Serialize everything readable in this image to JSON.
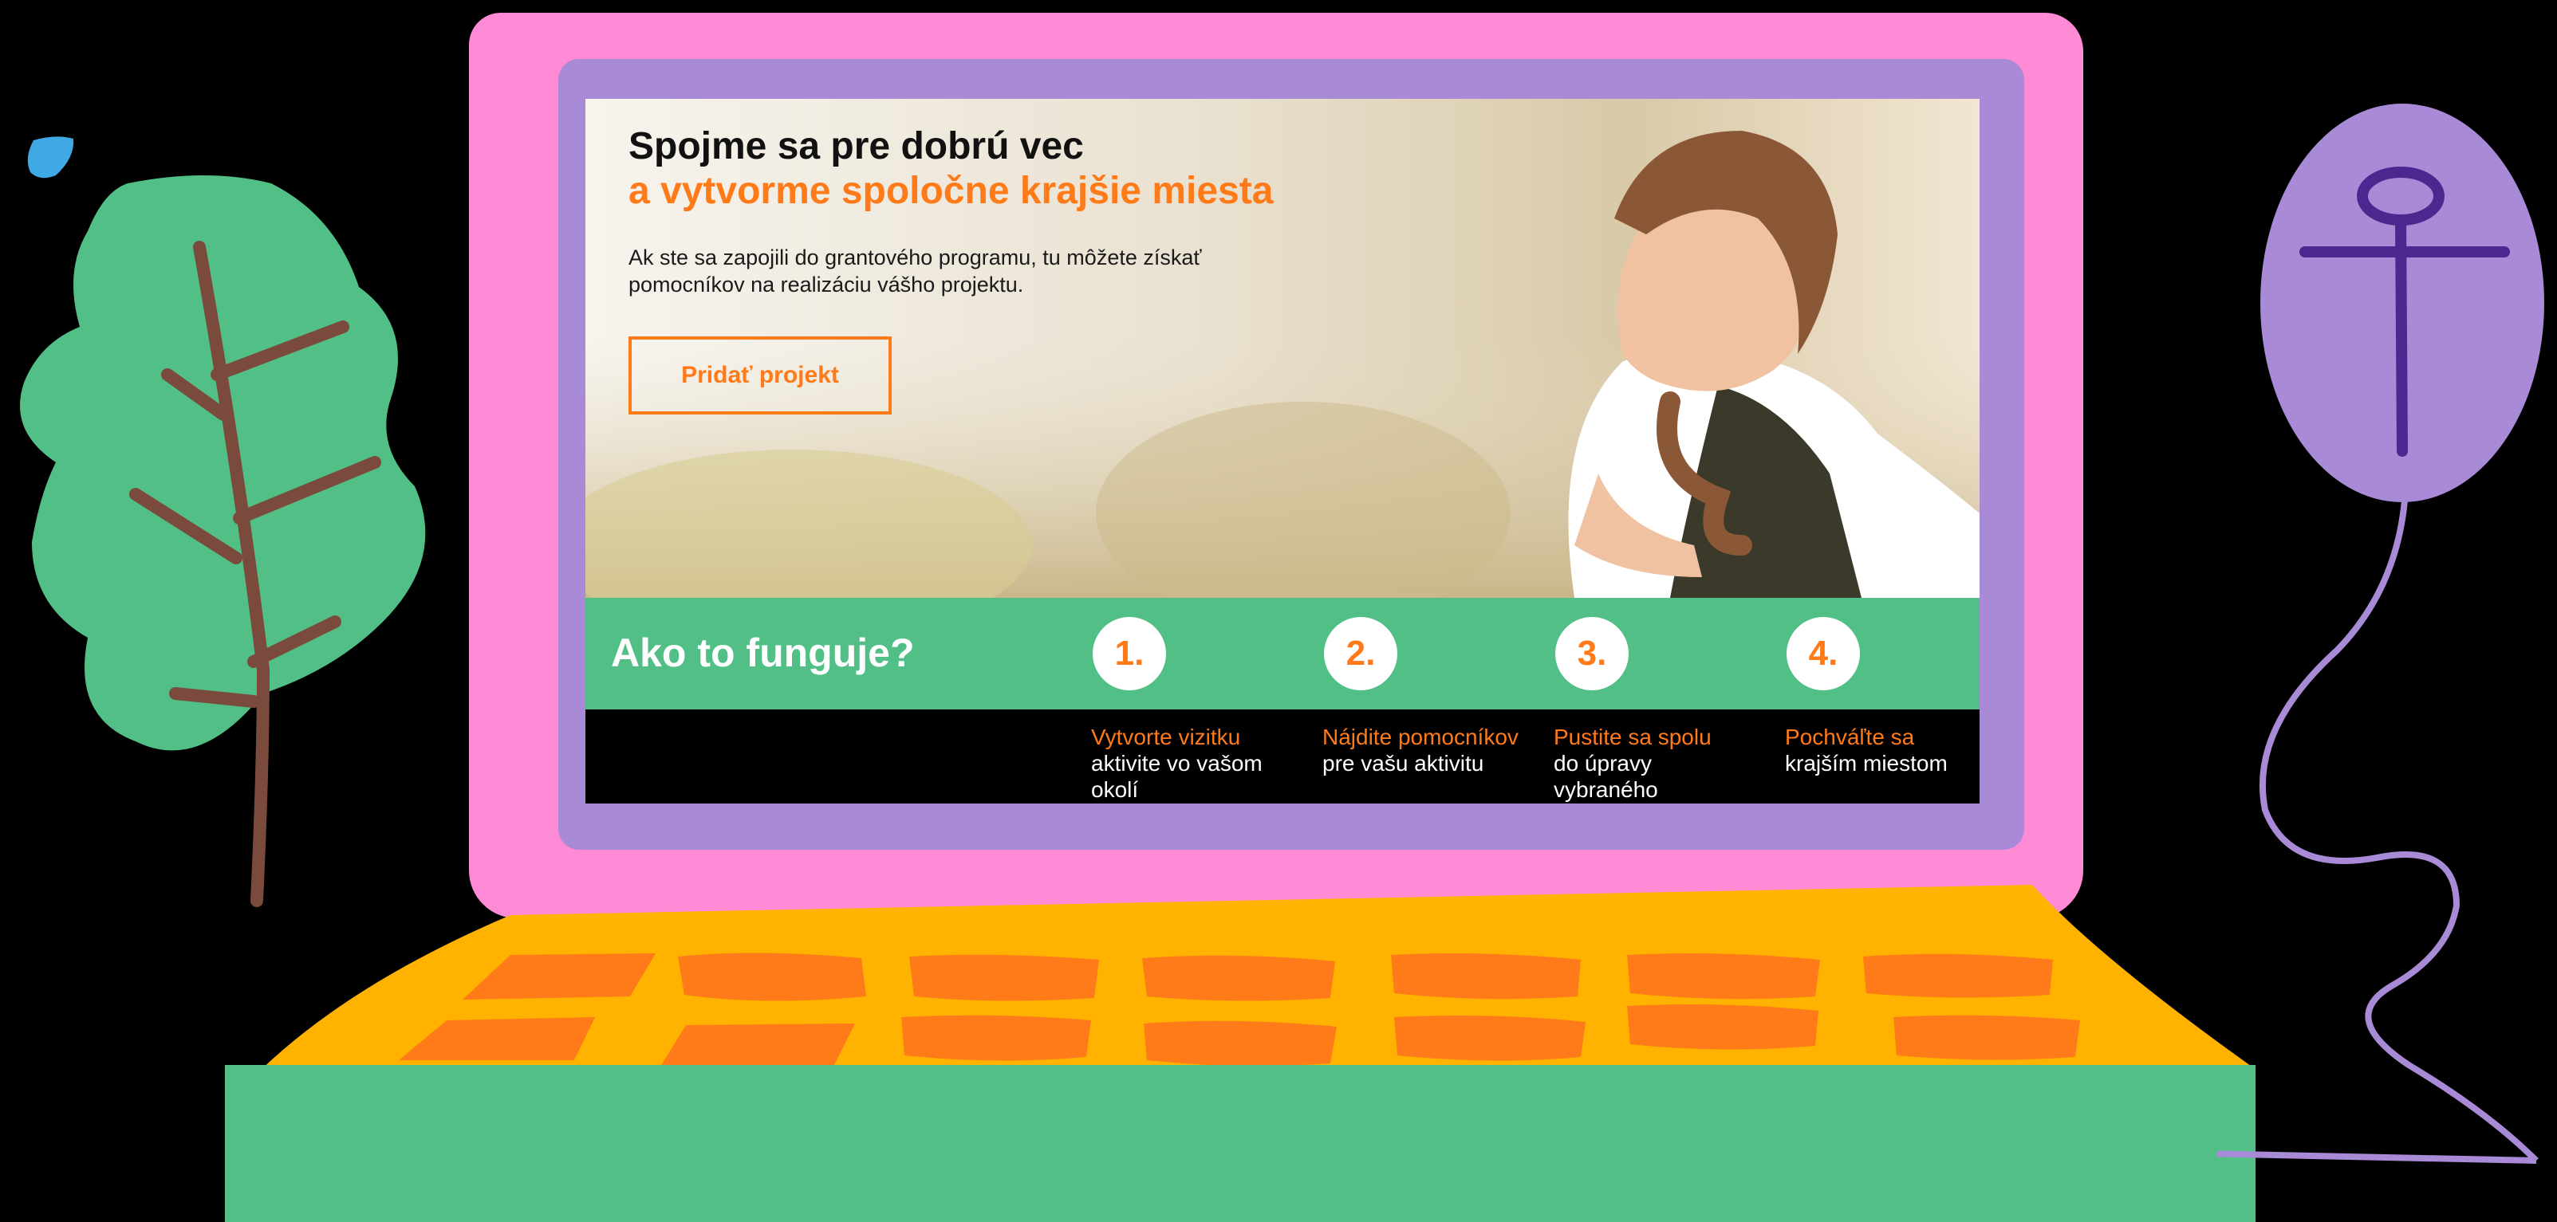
{
  "hero": {
    "headline_line1": "Spojme sa pre dobrú vec",
    "headline_line2": "a vytvorme spoločne krajšie miesta",
    "intro": "Ak ste sa zapojili do grantového programu, tu môžete získať pomocníkov na realizáciu vášho projektu.",
    "cta_label": "Pridať projekt"
  },
  "how_it_works": {
    "title": "Ako to funguje?",
    "steps": [
      {
        "number": "1.",
        "highlight": "Vytvorte vizitku",
        "text": "aktivite vo vašom okolí"
      },
      {
        "number": "2.",
        "highlight": "Nájdite pomocníkov",
        "text": "pre vašu aktivitu"
      },
      {
        "number": "3.",
        "highlight": "Pustite sa spolu",
        "text": "do úpravy vybraného"
      },
      {
        "number": "4.",
        "highlight": "Pochváľte sa",
        "text": "krajším miestom"
      }
    ]
  },
  "colors": {
    "accent_orange": "#ff7a18",
    "band_green": "#52bf87",
    "lid_pink": "#ff8ad6",
    "bezel_purple": "#a98ad6",
    "keyboard_yellow": "#ffb300"
  },
  "icons": [
    "plant-illustration",
    "water-drop-icon",
    "computer-mouse-icon"
  ]
}
